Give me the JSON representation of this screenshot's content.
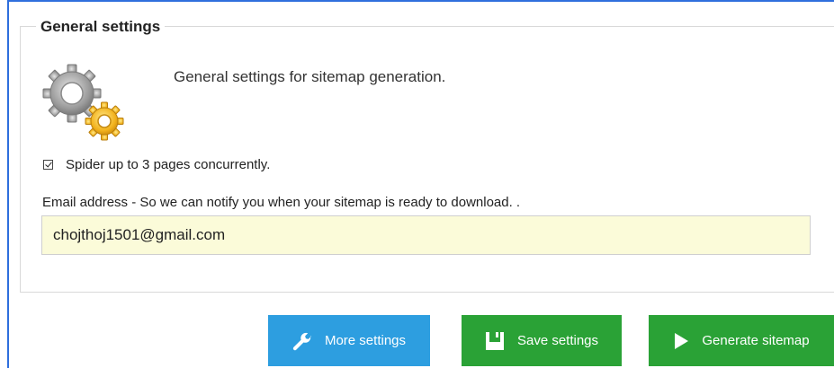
{
  "panel": {
    "legend": "General settings",
    "intro": "General settings for sitemap generation.",
    "icon": "settings-gears-icon"
  },
  "concurrency": {
    "checked": true,
    "label": "Spider up to 3 pages concurrently."
  },
  "email": {
    "label": "Email address - So we can notify you when your sitemap is ready to download. .",
    "value": "chojthoj1501@gmail.com"
  },
  "buttons": {
    "more_settings": {
      "label": "More settings",
      "icon": "wrench-icon",
      "color": "#2d9ee0"
    },
    "save_settings": {
      "label": "Save settings",
      "icon": "save-icon",
      "color": "#2aa236"
    },
    "generate_sitemap": {
      "label": "Generate sitemap",
      "icon": "play-icon",
      "color": "#2aa236"
    }
  },
  "colors": {
    "frame": "#2f6fdd",
    "input_bg": "#fbfbd9"
  }
}
